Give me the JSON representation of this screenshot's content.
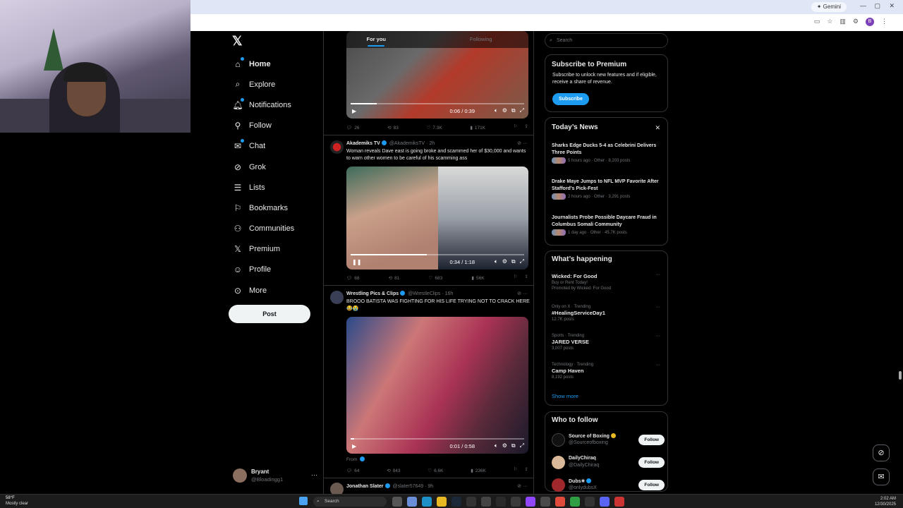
{
  "browser": {
    "gemini_label": "Gemini"
  },
  "nav": {
    "items": [
      {
        "label": "Home",
        "icon": "home-icon"
      },
      {
        "label": "Explore",
        "icon": "search-icon"
      },
      {
        "label": "Notifications",
        "icon": "bell-icon"
      },
      {
        "label": "Follow",
        "icon": "person-add-icon"
      },
      {
        "label": "Chat",
        "icon": "mail-icon"
      },
      {
        "label": "Grok",
        "icon": "grok-icon"
      },
      {
        "label": "Lists",
        "icon": "list-icon"
      },
      {
        "label": "Bookmarks",
        "icon": "bookmark-icon"
      },
      {
        "label": "Communities",
        "icon": "people-icon"
      },
      {
        "label": "Premium",
        "icon": "x-logo-icon"
      },
      {
        "label": "Profile",
        "icon": "person-icon"
      },
      {
        "label": "More",
        "icon": "more-circle-icon"
      }
    ],
    "post_label": "Post"
  },
  "account": {
    "name": "Bryant",
    "handle": "@Bloadingg1"
  },
  "timeline": {
    "tabs": [
      "For you",
      "Following"
    ],
    "tweets": [
      {
        "video_time": "0:06 / 0:39",
        "progress": 0.15,
        "replies": "26",
        "reposts": "83",
        "likes": "7.3K",
        "views": "171K"
      },
      {
        "name": "Akademiks TV",
        "handle": "@AkademiksTV · 2h",
        "text": "Woman reveals Dave east is going broke and scammed her of $30,000 and wants to warn other women to be careful of his scamming ass",
        "video_time": "0:34 / 1:18",
        "progress": 0.44,
        "replies": "68",
        "reposts": "81",
        "likes": "683",
        "views": "56K"
      },
      {
        "name": "Wrestling Pics & Clips",
        "handle": "@WrestleClips · 16h",
        "text": "BROOO BATISTA WAS FIGHTING FOR HIS LIFE TRYING NOT TO CRACK HERE 😂😭",
        "video_time": "0:01 / 0:58",
        "progress": 0.02,
        "from_label": "From",
        "replies": "64",
        "reposts": "843",
        "likes": "6.6K",
        "views": "236K"
      },
      {
        "name": "Jonathan Slater",
        "handle": "@slater57649 · 9h"
      }
    ]
  },
  "sidebar": {
    "search_placeholder": "Search",
    "premium": {
      "title": "Subscribe to Premium",
      "desc": "Subscribe to unlock new features and if eligible, receive a share of revenue.",
      "button": "Subscribe"
    },
    "news": {
      "title": "Today’s News",
      "items": [
        {
          "title": "Sharks Edge Ducks 5-4 as Celebrini Delivers Three Points",
          "meta": "5 hours ago · Other · 8,203 posts"
        },
        {
          "title": "Drake Maye Jumps to NFL MVP Favorite After Stafford's Pick-Fest",
          "meta": "2 hours ago · Other · 3,291 posts"
        },
        {
          "title": "Journalists Probe Possible Daycare Fraud in Columbus Somali Community",
          "meta": "1 day ago · Other · 45.7K posts"
        }
      ]
    },
    "happening": {
      "title": "What’s happening",
      "items": [
        {
          "context": "",
          "name": "Wicked: For Good",
          "sub": "Buy or Rent Today!",
          "extra": "Promoted by Wicked: For Good"
        },
        {
          "context": "Only on X · Trending",
          "name": "#HealingServiceDay1",
          "sub": "12.7K posts",
          "extra": ""
        },
        {
          "context": "Sports · Trending",
          "name": "JARED VERSE",
          "sub": "3,007 posts",
          "extra": ""
        },
        {
          "context": "Technology · Trending",
          "name": "Camp Haven",
          "sub": "8,192 posts",
          "extra": ""
        }
      ],
      "show_more": "Show more"
    },
    "who_to_follow": {
      "title": "Who to follow",
      "items": [
        {
          "name": "Source of Boxing",
          "handle": "@Sourceofboxing",
          "button": "Follow"
        },
        {
          "name": "DailyChiraq",
          "handle": "@DailyChiraq",
          "button": "Follow"
        },
        {
          "name": "Dubs✳",
          "handle": "@onlydubsX",
          "button": "Follow"
        }
      ]
    }
  },
  "taskbar": {
    "temp": "58°F",
    "weather": "Mostly clear",
    "search": "Search",
    "time": "2:02 AM",
    "date": "12/30/2025"
  },
  "colors": {
    "accent": "#1d9bf0",
    "background": "#000000",
    "border": "#2f3336",
    "muted": "#71767b"
  }
}
